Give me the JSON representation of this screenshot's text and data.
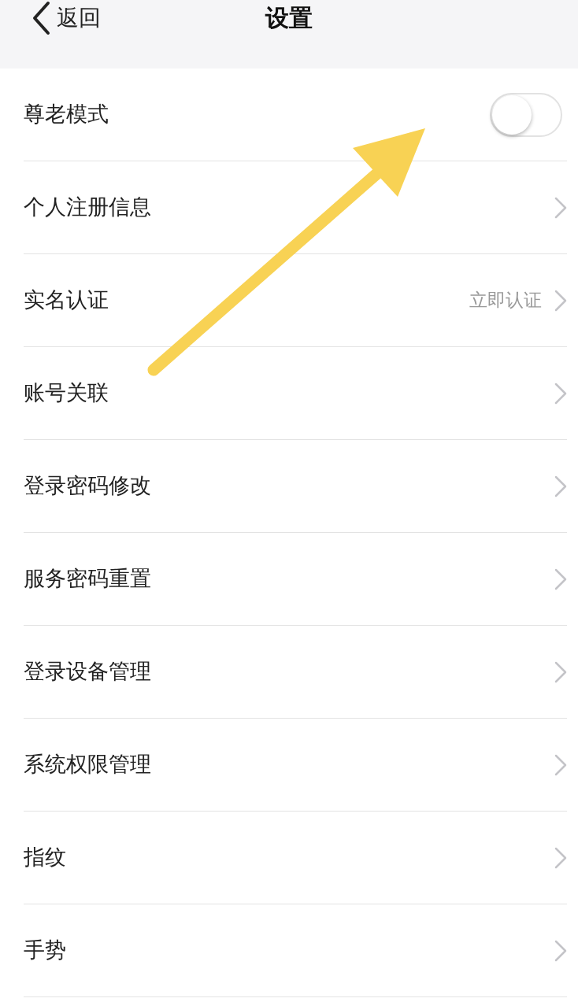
{
  "header": {
    "back_label": "返回",
    "title": "设置"
  },
  "items": [
    {
      "kind": "toggle",
      "label": "尊老模式",
      "on": false
    },
    {
      "kind": "link",
      "label": "个人注册信息"
    },
    {
      "kind": "link",
      "label": "实名认证",
      "value": "立即认证"
    },
    {
      "kind": "link",
      "label": "账号关联"
    },
    {
      "kind": "link",
      "label": "登录密码修改"
    },
    {
      "kind": "link",
      "label": "服务密码重置"
    },
    {
      "kind": "link",
      "label": "登录设备管理"
    },
    {
      "kind": "link",
      "label": "系统权限管理"
    },
    {
      "kind": "link",
      "label": "指纹"
    },
    {
      "kind": "link",
      "label": "手势"
    }
  ]
}
